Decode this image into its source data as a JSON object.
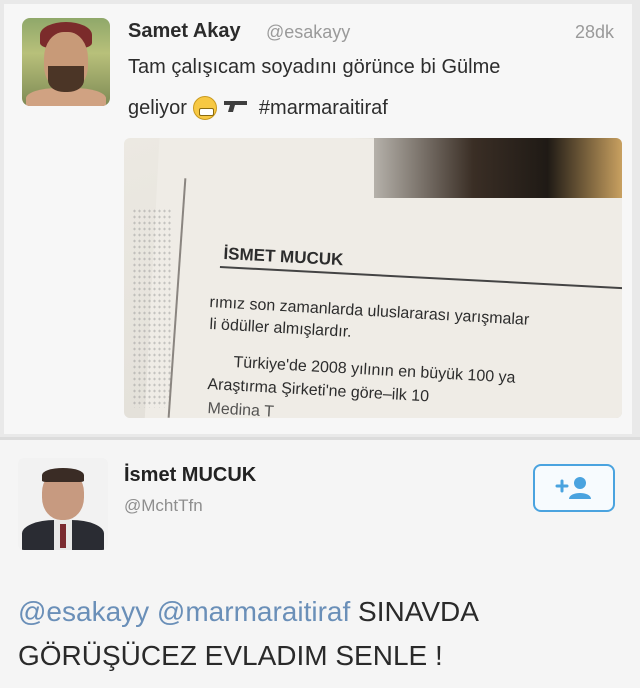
{
  "tweet1": {
    "name": "Samet Akay",
    "handle": "@esakayy",
    "time": "28dk",
    "text_line1": "Tam çalışıcam soyadını görünce bi Gülme",
    "text_line2_prefix": "geliyor",
    "emoji_icon": "grimacing-face-icon",
    "gun_icon": "pistol-icon",
    "hashtag": "#marmaraitiraf",
    "photo": {
      "heading": "İSMET MUCUK",
      "line1": "rımız son zamanlarda uluslararası yarışmalar",
      "line2": "li ödüller almışlardır.",
      "line3": "Türkiye'de 2008 yılının en büyük 100 ya",
      "line4": "Araştırma Şirketi'ne göre–ilk 10",
      "line5": "Medina T"
    }
  },
  "tweet2": {
    "name": "İsmet MUCUK",
    "handle": "@MchtTfn",
    "follow_icon": "add-user-icon",
    "mention1": "@esakayy",
    "mention2": "@marmaraitiraf",
    "text_rest1": "SINAVDA",
    "text_line2": "GÖRÜŞÜCEZ EVLADIM SENLE !"
  },
  "colors": {
    "link": "#6a8fb8",
    "follow_border": "#4aa3df",
    "muted": "#9a9a9a"
  }
}
